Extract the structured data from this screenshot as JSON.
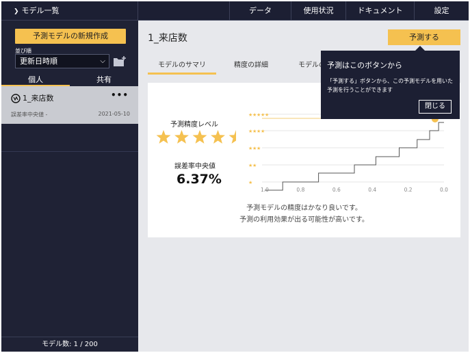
{
  "topbar": {
    "models_label": "モデル一覧",
    "nav": [
      "データ",
      "使用状況",
      "ドキュメント",
      "設定"
    ]
  },
  "sidebar": {
    "new_button": "予測モデルの新規作成",
    "sort_label": "並び順",
    "sort_value": "更新日時順",
    "tabs": [
      "個人",
      "共有"
    ],
    "model": {
      "name": "1_来店数",
      "sub": "誤差率中央値 -",
      "date": "2021-05-10",
      "menu": "•••"
    },
    "footer": "モデル数: 1 / 200"
  },
  "main": {
    "title": "1_来店数",
    "predict_button": "予測する",
    "tabs": [
      "モデルのサマリ",
      "精度の詳細",
      "モデルの"
    ],
    "summary": {
      "accuracy_label": "予測精度レベル",
      "rating": 4.5,
      "rating_max": 5,
      "error_label": "誤差率中央値",
      "error_value": "6.37%",
      "message_line1": "予測モデルの精度はかなり良いです。",
      "message_line2": "予測の利用効果が出る可能性が高いです。",
      "x_ticks": [
        "1.0",
        "0.8",
        "0.6",
        "0.4",
        "0.2",
        "0.0"
      ],
      "marker_value": 0.05
    }
  },
  "tooltip": {
    "title": "予測はこのボタンから",
    "body": "「予測する」ボタンから、この予測モデルを用いた予測を行うことができます",
    "close": "閉じる"
  },
  "colors": {
    "accent": "#f5c150",
    "dark": "#1f2235",
    "topbar": "#1c1f33"
  }
}
